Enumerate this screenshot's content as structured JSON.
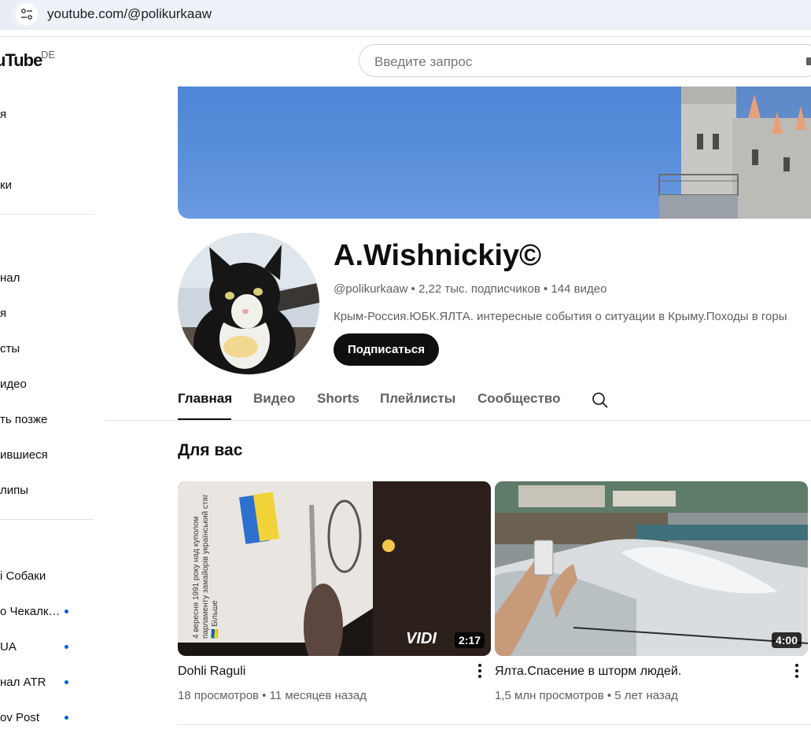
{
  "browser": {
    "url": "youtube.com/@polikurkaaw"
  },
  "masthead": {
    "logo_text": "uTube",
    "country_code": "DE",
    "search_placeholder": "Введите запрос"
  },
  "sidebar": {
    "items": [
      {
        "label": "я"
      },
      {
        "label": "ки"
      },
      {
        "label": "нал"
      },
      {
        "label": "я"
      },
      {
        "label": "сты"
      },
      {
        "label": "идео"
      },
      {
        "label": "ть позже"
      },
      {
        "label": "ившиеся"
      },
      {
        "label": "липы"
      }
    ],
    "subscriptions": [
      {
        "label": "i Собаки",
        "new": false
      },
      {
        "label": "о Чекалк…",
        "new": true
      },
      {
        "label": "UA",
        "new": true
      },
      {
        "label": "нал ATR",
        "new": true
      },
      {
        "label": "ov Post",
        "new": true
      }
    ]
  },
  "channel": {
    "name": "A.Wishnickiy©",
    "handle": "@polikurkaaw",
    "subscribers": "2,22 тыс. подписчиков",
    "videos": "144 видео",
    "meta_sep": " • ",
    "description": "Крым-Россия.ЮБК.ЯЛТА. интересные события о ситуации в Крыму.Походы в горы",
    "subscribe_label": "Подписаться"
  },
  "tabs": [
    {
      "label": "Главная",
      "active": true
    },
    {
      "label": "Видео",
      "active": false
    },
    {
      "label": "Shorts",
      "active": false
    },
    {
      "label": "Плейлисты",
      "active": false
    },
    {
      "label": "Сообщество",
      "active": false
    }
  ],
  "section": {
    "title": "Для вас"
  },
  "videos": [
    {
      "title": "Dohli Raguli",
      "views": "18 просмотров",
      "age": "11 месяцев назад",
      "duration": "2:17",
      "watermark": "VIDI",
      "overlay_text": "4 вересня 1991 року над куполом парламенту замайорів український стяг 🇺🇦 Більше"
    },
    {
      "title": "Ялта.Спасение в шторм людей.",
      "views": "1,5 млн просмотров",
      "age": "5 лет назад",
      "duration": "4:00"
    }
  ],
  "colors": {
    "accent_link": "#065fd4",
    "text_primary": "#0f0f0f",
    "text_secondary": "#606060"
  }
}
